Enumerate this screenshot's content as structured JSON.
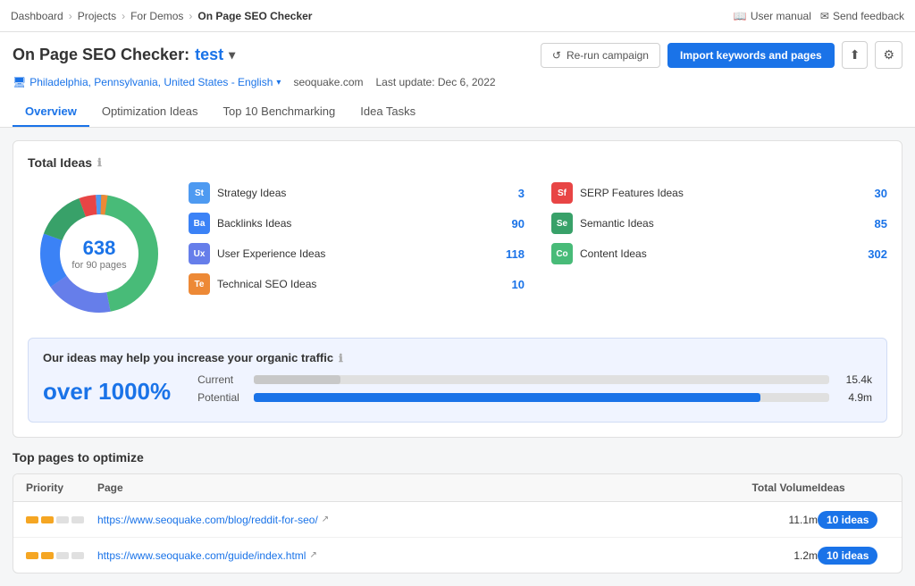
{
  "topbar": {
    "breadcrumbs": [
      "Dashboard",
      "Projects",
      "For Demos",
      "On Page SEO Checker"
    ],
    "user_manual": "User manual",
    "send_feedback": "Send feedback"
  },
  "header": {
    "title": "On Page SEO Checker:",
    "keyword": "test",
    "rerun_label": "Re-run campaign",
    "import_label": "Import keywords and pages",
    "location": "Philadelphia, Pennsylvania, United States - English",
    "domain": "seoquake.com",
    "last_update": "Last update: Dec 6, 2022"
  },
  "tabs": [
    {
      "label": "Overview",
      "active": true
    },
    {
      "label": "Optimization Ideas",
      "active": false
    },
    {
      "label": "Top 10 Benchmarking",
      "active": false
    },
    {
      "label": "Idea Tasks",
      "active": false
    }
  ],
  "total_ideas": {
    "title": "Total Ideas",
    "count": "638",
    "sub": "for 90 pages",
    "items": [
      {
        "label": "Strategy Ideas",
        "count": "3",
        "badge_text": "St",
        "badge_color": "#4e9af1"
      },
      {
        "label": "SERP Features Ideas",
        "count": "30",
        "badge_text": "Sf",
        "badge_color": "#e84545"
      },
      {
        "label": "Backlinks Ideas",
        "count": "90",
        "badge_text": "Ba",
        "badge_color": "#3b82f6"
      },
      {
        "label": "Semantic Ideas",
        "count": "85",
        "badge_text": "Se",
        "badge_color": "#38a169"
      },
      {
        "label": "User Experience Ideas",
        "count": "118",
        "badge_text": "Ux",
        "badge_color": "#667eea"
      },
      {
        "label": "Content Ideas",
        "count": "302",
        "badge_text": "Co",
        "badge_color": "#48bb78"
      },
      {
        "label": "Technical SEO Ideas",
        "count": "10",
        "badge_text": "Te",
        "badge_color": "#ed8936"
      }
    ]
  },
  "traffic": {
    "title": "Our ideas may help you increase your organic traffic",
    "percent": "over 1000%",
    "current_label": "Current",
    "current_value": "15.4k",
    "potential_label": "Potential",
    "potential_value": "4.9m"
  },
  "top_pages": {
    "title": "Top pages to optimize",
    "columns": [
      "Priority",
      "Page",
      "Total Volume",
      "Ideas"
    ],
    "rows": [
      {
        "priority_dots": [
          true,
          true,
          false,
          false
        ],
        "page": "https://www.seoquake.com/blog/reddit-for-seo/",
        "volume": "11.1m",
        "ideas": "10 ideas"
      },
      {
        "priority_dots": [
          true,
          true,
          false,
          false
        ],
        "page": "https://www.seoquake.com/guide/index.html",
        "volume": "1.2m",
        "ideas": "10 ideas"
      }
    ]
  }
}
